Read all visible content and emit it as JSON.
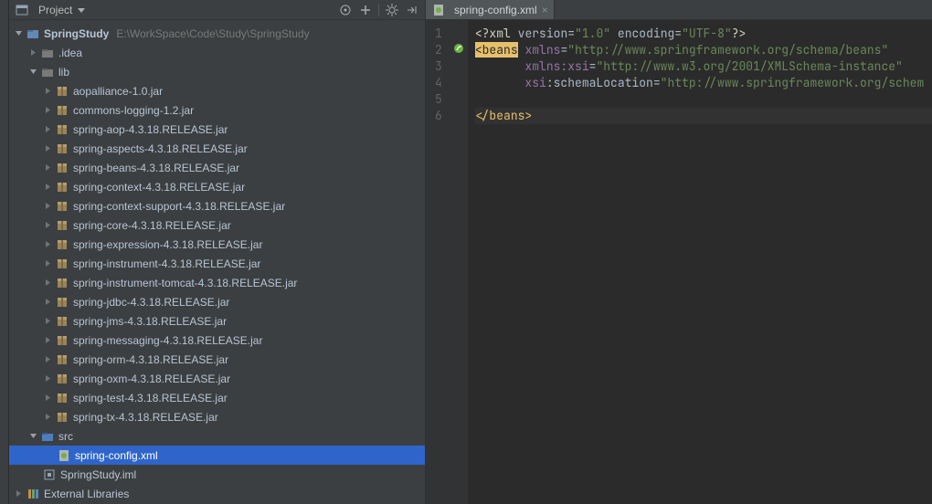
{
  "panel": {
    "title": "Project"
  },
  "project": {
    "name": "SpringStudy",
    "path": "E:\\WorkSpace\\Code\\Study\\SpringStudy",
    "idea_folder": ".idea",
    "lib_folder": "lib",
    "lib_items": [
      "aopalliance-1.0.jar",
      "commons-logging-1.2.jar",
      "spring-aop-4.3.18.RELEASE.jar",
      "spring-aspects-4.3.18.RELEASE.jar",
      "spring-beans-4.3.18.RELEASE.jar",
      "spring-context-4.3.18.RELEASE.jar",
      "spring-context-support-4.3.18.RELEASE.jar",
      "spring-core-4.3.18.RELEASE.jar",
      "spring-expression-4.3.18.RELEASE.jar",
      "spring-instrument-4.3.18.RELEASE.jar",
      "spring-instrument-tomcat-4.3.18.RELEASE.jar",
      "spring-jdbc-4.3.18.RELEASE.jar",
      "spring-jms-4.3.18.RELEASE.jar",
      "spring-messaging-4.3.18.RELEASE.jar",
      "spring-orm-4.3.18.RELEASE.jar",
      "spring-oxm-4.3.18.RELEASE.jar",
      "spring-test-4.3.18.RELEASE.jar",
      "spring-tx-4.3.18.RELEASE.jar"
    ],
    "src_folder": "src",
    "src_file": "spring-config.xml",
    "iml_file": "SpringStudy.iml",
    "external": "External Libraries"
  },
  "editor": {
    "tab_label": "spring-config.xml",
    "caret_line": 6,
    "lines": {
      "l1_a": "<?xml",
      "l1_b": "version",
      "l1_c": "=",
      "l1_d": "\"1.0\"",
      "l1_e": "encoding",
      "l1_f": "=",
      "l1_g": "\"UTF-8\"",
      "l1_h": "?>",
      "l2_a": "<beans",
      "l2_b": "xmlns",
      "l2_c": "=",
      "l2_d": "\"http://www.springframework.org/schema/beans\"",
      "l3_a": "xmlns:xsi",
      "l3_b": "=",
      "l3_c": "\"http://www.w3.org/2001/XMLSchema-instance\"",
      "l4_a": "xsi",
      "l4_b": ":schemaLocation",
      "l4_c": "=",
      "l4_d": "\"http://www.springframework.org/schem",
      "l6_a": "</beans>"
    }
  }
}
